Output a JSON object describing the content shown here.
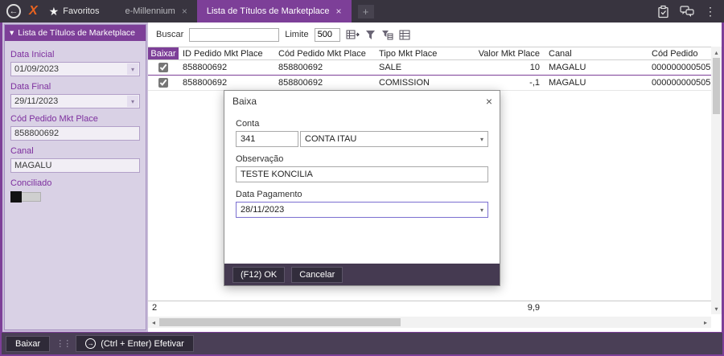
{
  "icons": {
    "back_arrow": "←",
    "star": "★",
    "close": "×",
    "add_tab": "+",
    "menu_dots": "⋮",
    "dropdown": "▾",
    "panel_collapse": "▾",
    "scroll_up": "▴",
    "scroll_down": "▾",
    "scroll_left": "◂",
    "scroll_right": "▸",
    "grip": "⋮⋮",
    "efetivar_arrow": "→"
  },
  "colors": {
    "accent": "#7d3f98",
    "topbar": "#38343f",
    "sidebar": "#d9d1e5",
    "bottombar": "#4a3f56"
  },
  "topbar": {
    "favorites_label": "Favoritos",
    "tabs": [
      {
        "label": "e-Millennium",
        "active": false
      },
      {
        "label": "Lista de Títulos de Marketplace",
        "active": true
      }
    ]
  },
  "sidebar": {
    "header": "Lista de Títulos de Marketplace",
    "fields": {
      "data_inicial_label": "Data Inicial",
      "data_inicial_value": "01/09/2023",
      "data_final_label": "Data Final",
      "data_final_value": "29/11/2023",
      "cod_pedido_label": "Cód Pedido Mkt Place",
      "cod_pedido_value": "858800692",
      "canal_label": "Canal",
      "canal_value": "MAGALU",
      "conciliado_label": "Conciliado"
    }
  },
  "toolbar": {
    "buscar_label": "Buscar",
    "buscar_value": "",
    "limite_label": "Limite",
    "limite_value": "500"
  },
  "table": {
    "columns": [
      "Baixar",
      "ID Pedido Mkt Place",
      "Cód Pedido Mkt Place",
      "Tipo Mkt Place",
      "Valor Mkt Place",
      "Canal",
      "Cód Pedido"
    ],
    "rows": [
      {
        "checked": true,
        "id_pedido_mkt": "858800692",
        "cod_pedido_mkt": "858800692",
        "tipo": "SALE",
        "valor": "10",
        "canal": "MAGALU",
        "cod_pedido": "000000000505"
      },
      {
        "checked": true,
        "id_pedido_mkt": "858800692",
        "cod_pedido_mkt": "858800692",
        "tipo": "COMISSION",
        "valor": "-,1",
        "canal": "MAGALU",
        "cod_pedido": "000000000505"
      }
    ],
    "summary_count": "2",
    "summary_valor": "9,9"
  },
  "modal": {
    "title": "Baixa",
    "conta_label": "Conta",
    "conta_code": "341",
    "conta_name": "CONTA ITAU",
    "observacao_label": "Observação",
    "observacao_value": "TESTE KONCILIA",
    "data_pagamento_label": "Data Pagamento",
    "data_pagamento_value": "28/11/2023",
    "ok_label": "(F12) OK",
    "cancel_label": "Cancelar"
  },
  "bottombar": {
    "baixar_label": "Baixar",
    "efetivar_label": "(Ctrl + Enter) Efetivar"
  }
}
